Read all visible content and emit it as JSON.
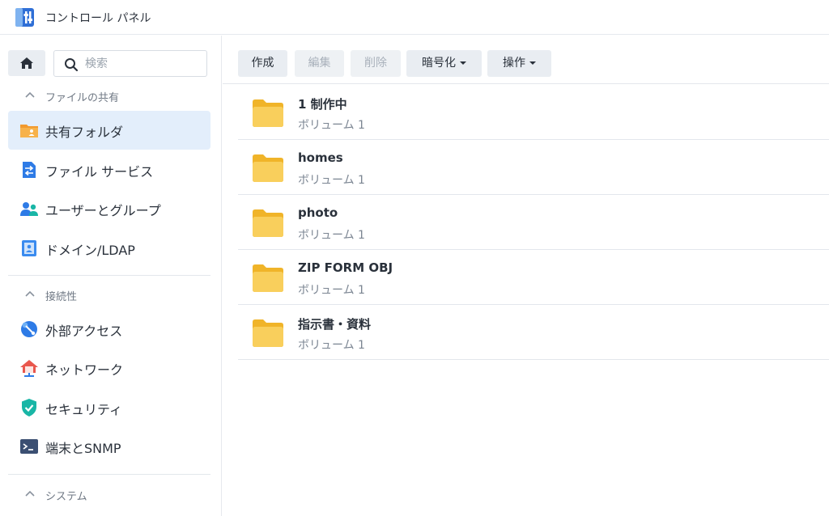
{
  "window": {
    "title": "コントロール パネル"
  },
  "search": {
    "placeholder": "検索"
  },
  "sidebar": {
    "sections": [
      {
        "label": "ファイルの共有"
      },
      {
        "label": "接続性"
      },
      {
        "label": "システム"
      }
    ],
    "items": [
      {
        "label": "共有フォルダ",
        "icon": "shared-folder-icon",
        "active": true
      },
      {
        "label": "ファイル サービス",
        "icon": "file-services-icon"
      },
      {
        "label": "ユーザーとグループ",
        "icon": "users-groups-icon"
      },
      {
        "label": "ドメイン/LDAP",
        "icon": "domain-ldap-icon"
      },
      {
        "label": "外部アクセス",
        "icon": "external-access-icon"
      },
      {
        "label": "ネットワーク",
        "icon": "network-icon"
      },
      {
        "label": "セキュリティ",
        "icon": "security-shield-icon"
      },
      {
        "label": "端末とSNMP",
        "icon": "terminal-icon"
      }
    ]
  },
  "toolbar": {
    "create": "作成",
    "edit": "編集",
    "delete": "削除",
    "encrypt": "暗号化",
    "action": "操作"
  },
  "folders": [
    {
      "name": "1 制作中",
      "volume": "ボリューム 1"
    },
    {
      "name": "homes",
      "volume": "ボリューム 1"
    },
    {
      "name": "photo",
      "volume": "ボリューム 1"
    },
    {
      "name": "ZIP FORM OBJ",
      "volume": "ボリューム 1"
    },
    {
      "name": "指示書・資料",
      "volume": "ボリューム 1"
    }
  ],
  "colors": {
    "accent": "#1f7ae0",
    "active_bg": "#e3eefb",
    "folder": "#f6c343"
  }
}
